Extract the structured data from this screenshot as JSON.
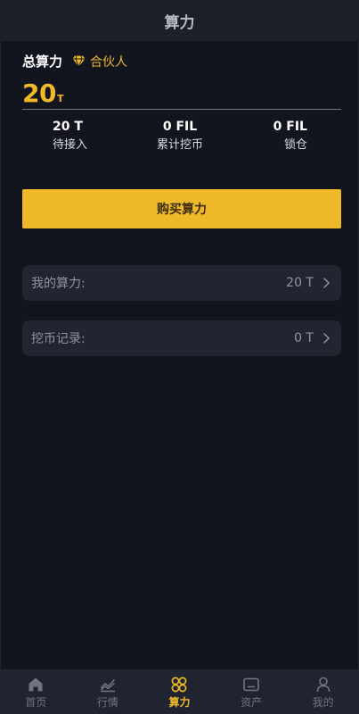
{
  "header": {
    "title": "算力"
  },
  "summary": {
    "total_label": "总算力",
    "partner_label": "合伙人",
    "total_value": "20",
    "total_unit": "T"
  },
  "stats": [
    {
      "value": "20 T",
      "label": "待接入"
    },
    {
      "value": "0 FIL",
      "label": "累计挖币"
    },
    {
      "value": "0 FIL",
      "label": "锁仓"
    }
  ],
  "buy_button_label": "购买算力",
  "rows": {
    "my_power": {
      "label": "我的算力:",
      "value": "20 T"
    },
    "mining_records": {
      "label": "挖币记录:",
      "value": "0 T"
    }
  },
  "tabbar": {
    "items": [
      {
        "label": "首页",
        "icon": "home-icon"
      },
      {
        "label": "行情",
        "icon": "chart-icon"
      },
      {
        "label": "算力",
        "icon": "hashrate-icon"
      },
      {
        "label": "资产",
        "icon": "wallet-icon"
      },
      {
        "label": "我的",
        "icon": "user-icon"
      }
    ],
    "active_index": 2
  },
  "colors": {
    "accent": "#f0b92a",
    "background": "#12151d",
    "card": "#20252f",
    "tabbar": "#1f2430",
    "inactive": "#70757f"
  }
}
